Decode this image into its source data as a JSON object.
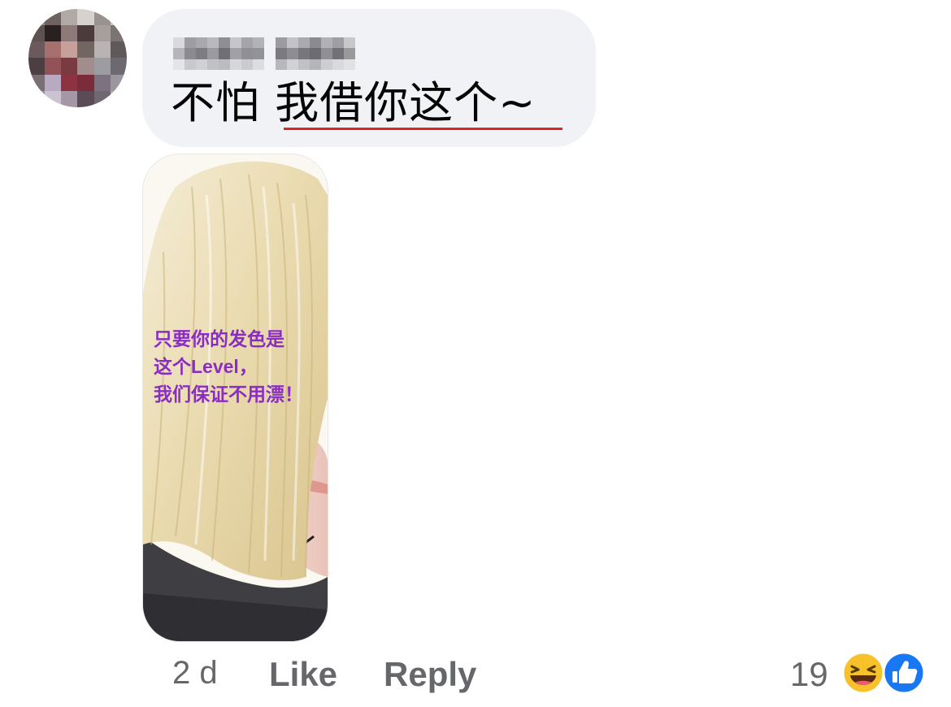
{
  "comment": {
    "author_name": "",
    "text": "不怕 我借你这个~",
    "image": {
      "caption": "只要你的发色是\n这个Level，\n我们保证不用漂！"
    }
  },
  "footer": {
    "timestamp": "2 d",
    "like_label": "Like",
    "reply_label": "Reply",
    "reaction_count": "19",
    "reaction_icons": [
      "haha-emoji-icon",
      "like-thumb-icon"
    ]
  },
  "colors": {
    "bubble": "#f0f2f5",
    "secondary_text": "#65676b",
    "spellcheck_underline": "#e02424",
    "caption": "#8a2ec2",
    "like_blue": "#1877f2"
  }
}
